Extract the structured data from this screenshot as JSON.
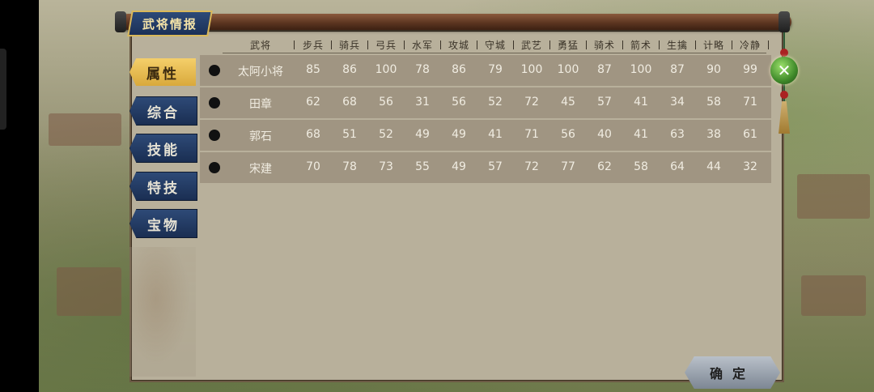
{
  "window": {
    "title": "武将情报"
  },
  "tabs": [
    {
      "label": "属性",
      "active": true
    },
    {
      "label": "综合",
      "active": false
    },
    {
      "label": "技能",
      "active": false
    },
    {
      "label": "特技",
      "active": false
    },
    {
      "label": "宝物",
      "active": false
    }
  ],
  "table": {
    "headers": [
      "武将",
      "步兵",
      "骑兵",
      "弓兵",
      "水军",
      "攻城",
      "守城",
      "武艺",
      "勇猛",
      "骑术",
      "箭术",
      "生擒",
      "计略",
      "冷静"
    ],
    "rows": [
      {
        "name": "太阿小将",
        "values": [
          "85",
          "86",
          "100",
          "78",
          "86",
          "79",
          "100",
          "100",
          "87",
          "100",
          "87",
          "90",
          "99"
        ]
      },
      {
        "name": "田章",
        "values": [
          "62",
          "68",
          "56",
          "31",
          "56",
          "52",
          "72",
          "45",
          "57",
          "41",
          "34",
          "58",
          "71"
        ]
      },
      {
        "name": "郭石",
        "values": [
          "68",
          "51",
          "52",
          "49",
          "49",
          "41",
          "71",
          "56",
          "40",
          "41",
          "63",
          "38",
          "61"
        ]
      },
      {
        "name": "宋建",
        "values": [
          "70",
          "78",
          "73",
          "55",
          "49",
          "57",
          "72",
          "77",
          "62",
          "58",
          "64",
          "44",
          "32"
        ]
      }
    ]
  },
  "close_button": {
    "icon": "close-icon",
    "glyph": "✕"
  },
  "confirm_button": {
    "label": "确定"
  }
}
